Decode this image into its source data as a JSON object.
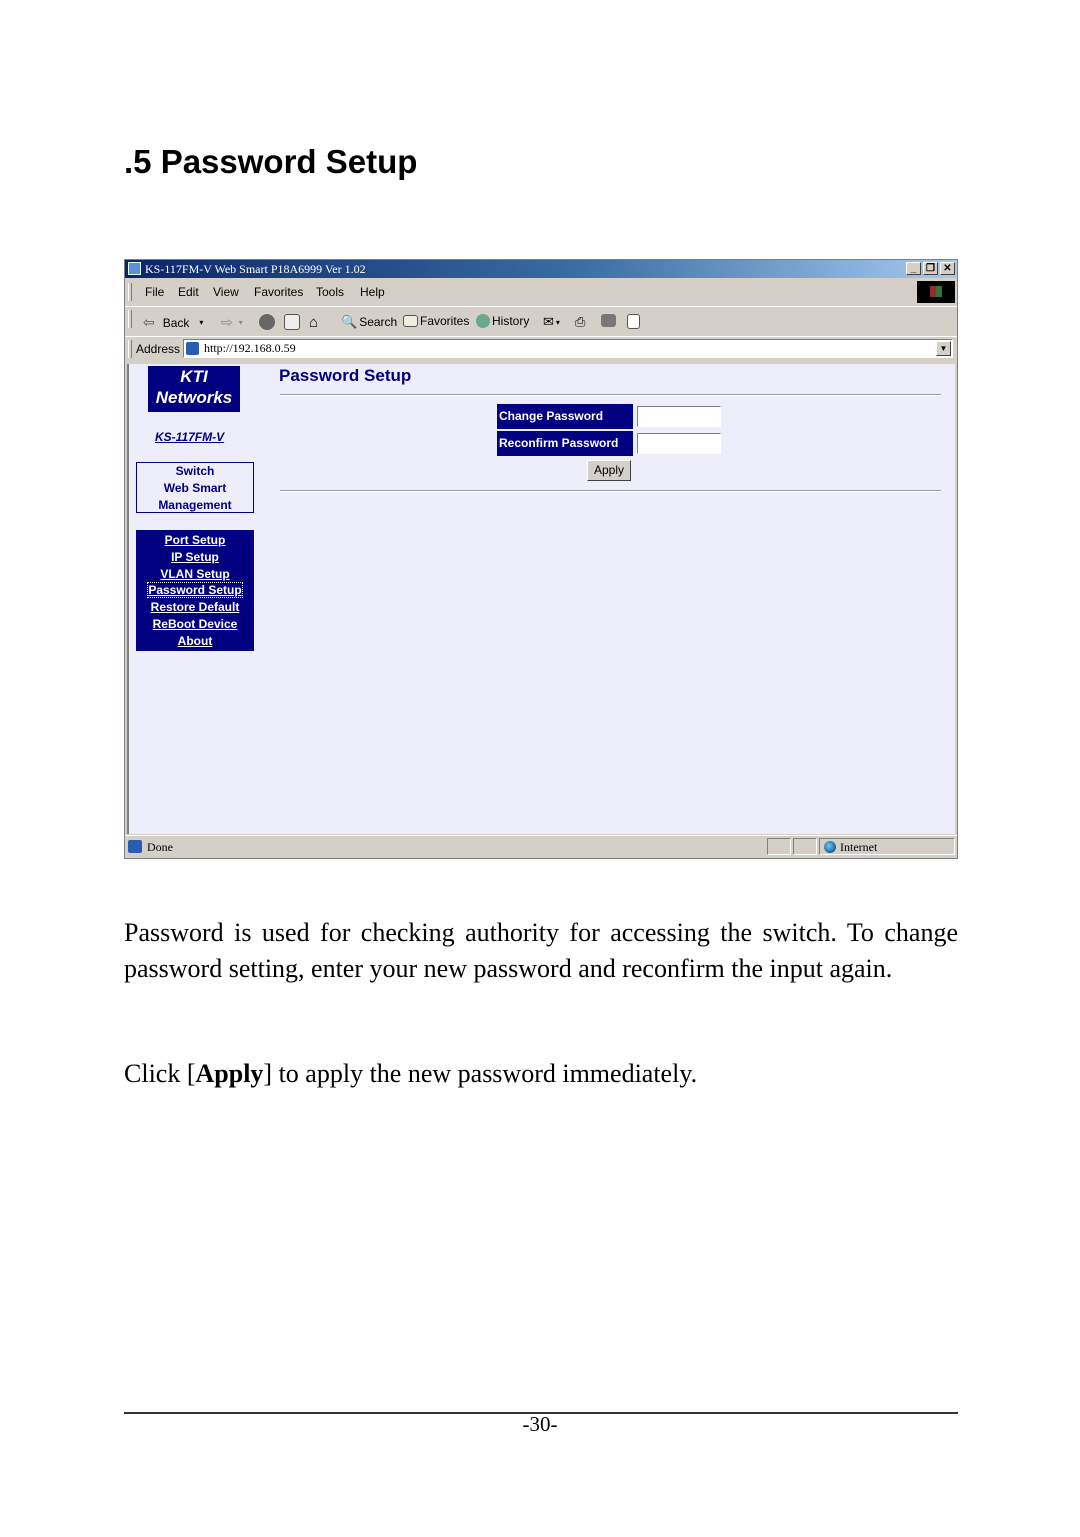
{
  "section_title": ".5 Password Setup",
  "browser": {
    "window_title": "KS-117FM-V Web Smart P18A6999 Ver 1.02",
    "window_controls": [
      "minimize",
      "restore",
      "close"
    ],
    "menu": [
      "File",
      "Edit",
      "View",
      "Favorites",
      "Tools",
      "Help"
    ],
    "toolbar": {
      "back": "Back",
      "search": "Search",
      "favorites": "Favorites",
      "history": "History"
    },
    "address_label": "Address",
    "address_url": "http://192.168.0.59",
    "status_text": "Done",
    "zone_text": "Internet"
  },
  "page": {
    "logo_line1": "KTI",
    "logo_line2": "Networks",
    "model": "KS-117FM-V",
    "mgmt_lines": [
      "Switch",
      "Web Smart",
      "Management"
    ],
    "nav": [
      {
        "label": "Port Setup"
      },
      {
        "label": "IP Setup"
      },
      {
        "label": "VLAN Setup"
      },
      {
        "label": "Password Setup",
        "active": true
      },
      {
        "label": "Restore Default"
      },
      {
        "label": "ReBoot Device"
      },
      {
        "label": "About"
      }
    ],
    "heading": "Password Setup",
    "form": {
      "change_label": "Change Password",
      "change_value": "",
      "reconfirm_label": "Reconfirm Password",
      "reconfirm_value": "",
      "apply_label": "Apply"
    }
  },
  "body_text": {
    "para1": "Password is used for checking authority for accessing the switch. To change password setting, enter your new password and reconfirm the input again.",
    "para2_prefix": "Click [",
    "para2_bold": "Apply",
    "para2_suffix": "] to apply the new password immediately."
  },
  "page_number": "-30-"
}
